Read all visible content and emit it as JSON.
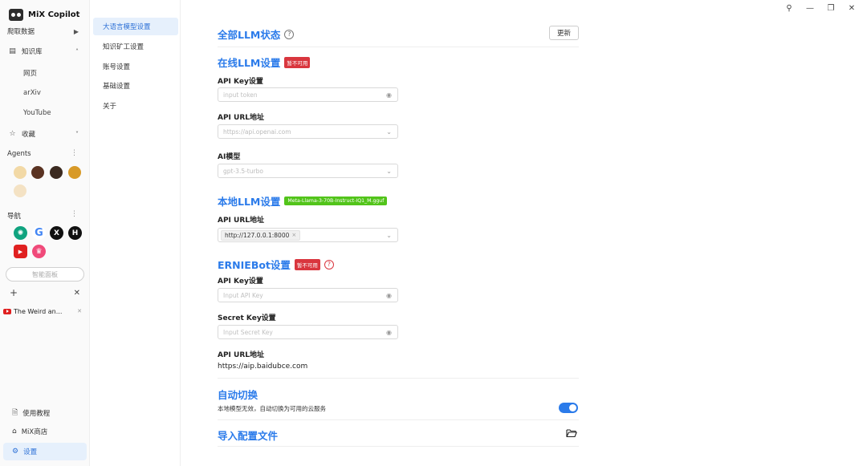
{
  "app": {
    "title": "MiX Copilot"
  },
  "window": {
    "pin": "⚲",
    "minimize": "—",
    "restore": "❐",
    "close": "✕"
  },
  "sidebar": {
    "crawl_label": "爬取数据",
    "knowledge_label": "知识库",
    "knowledge_items": [
      "网页",
      "arXiv",
      "YouTube"
    ],
    "favorites_label": "收藏",
    "agents_label": "Agents",
    "nav_label": "导航",
    "nav_icons": [
      {
        "name": "chatgpt-icon",
        "glyph": "✺",
        "color": "#10a37f"
      },
      {
        "name": "google-icon",
        "glyph": "G",
        "color": "#4285f4"
      },
      {
        "name": "x-icon",
        "glyph": "X",
        "color": "#111111"
      },
      {
        "name": "h-icon",
        "glyph": "H",
        "color": "#111111"
      },
      {
        "name": "youtube-icon",
        "glyph": "▶",
        "color": "#e02020"
      },
      {
        "name": "crown-icon",
        "glyph": "♛",
        "color": "#f04a7a"
      }
    ],
    "dashboard_label": "智能面板",
    "add_tab": "+",
    "close_tabs": "✕",
    "open_tab_title": "The Weird an...",
    "open_tab_close": "✕",
    "tutorial_label": "使用教程",
    "store_label": "MiX商店",
    "settings_label": "设置"
  },
  "settings_nav": {
    "items": [
      "大语言模型设置",
      "知识矿工设置",
      "账号设置",
      "基础设置",
      "关于"
    ],
    "active": "大语言模型设置"
  },
  "main": {
    "all_llm_title": "全部LLM状态",
    "update_button": "更新",
    "online": {
      "title": "在线LLM设置",
      "badge": "暂不可用",
      "api_key_label": "API Key设置",
      "api_key_placeholder": "input token",
      "api_url_label": "API URL地址",
      "api_url_placeholder": "https://api.openai.com",
      "model_label": "AI模型",
      "model_value": "gpt-3.5-turbo"
    },
    "local": {
      "title": "本地LLM设置",
      "badge": "Meta-Llama-3-70B-Instruct-IQ1_M.gguf",
      "api_url_label": "API URL地址",
      "api_url_tag": "http://127.0.0.1:8000",
      "tag_close": "×"
    },
    "ernie": {
      "title": "ERNIEBot设置",
      "badge": "暂不可用",
      "api_key_label": "API Key设置",
      "api_key_placeholder": "Input API Key",
      "secret_key_label": "Secret Key设置",
      "secret_key_placeholder": "Input Secret Key",
      "api_url_label": "API URL地址",
      "api_url_value": "https://aip.baidubce.com"
    },
    "auto_switch": {
      "title": "自动切换",
      "description": "本地模型无效，自动切换为可用的云服务",
      "enabled": true
    },
    "import_config": {
      "title": "导入配置文件"
    }
  },
  "colors": {
    "accent": "#2b7bea",
    "danger": "#d9363e",
    "success": "#52c41a",
    "active_bg": "#e6f0fc"
  }
}
